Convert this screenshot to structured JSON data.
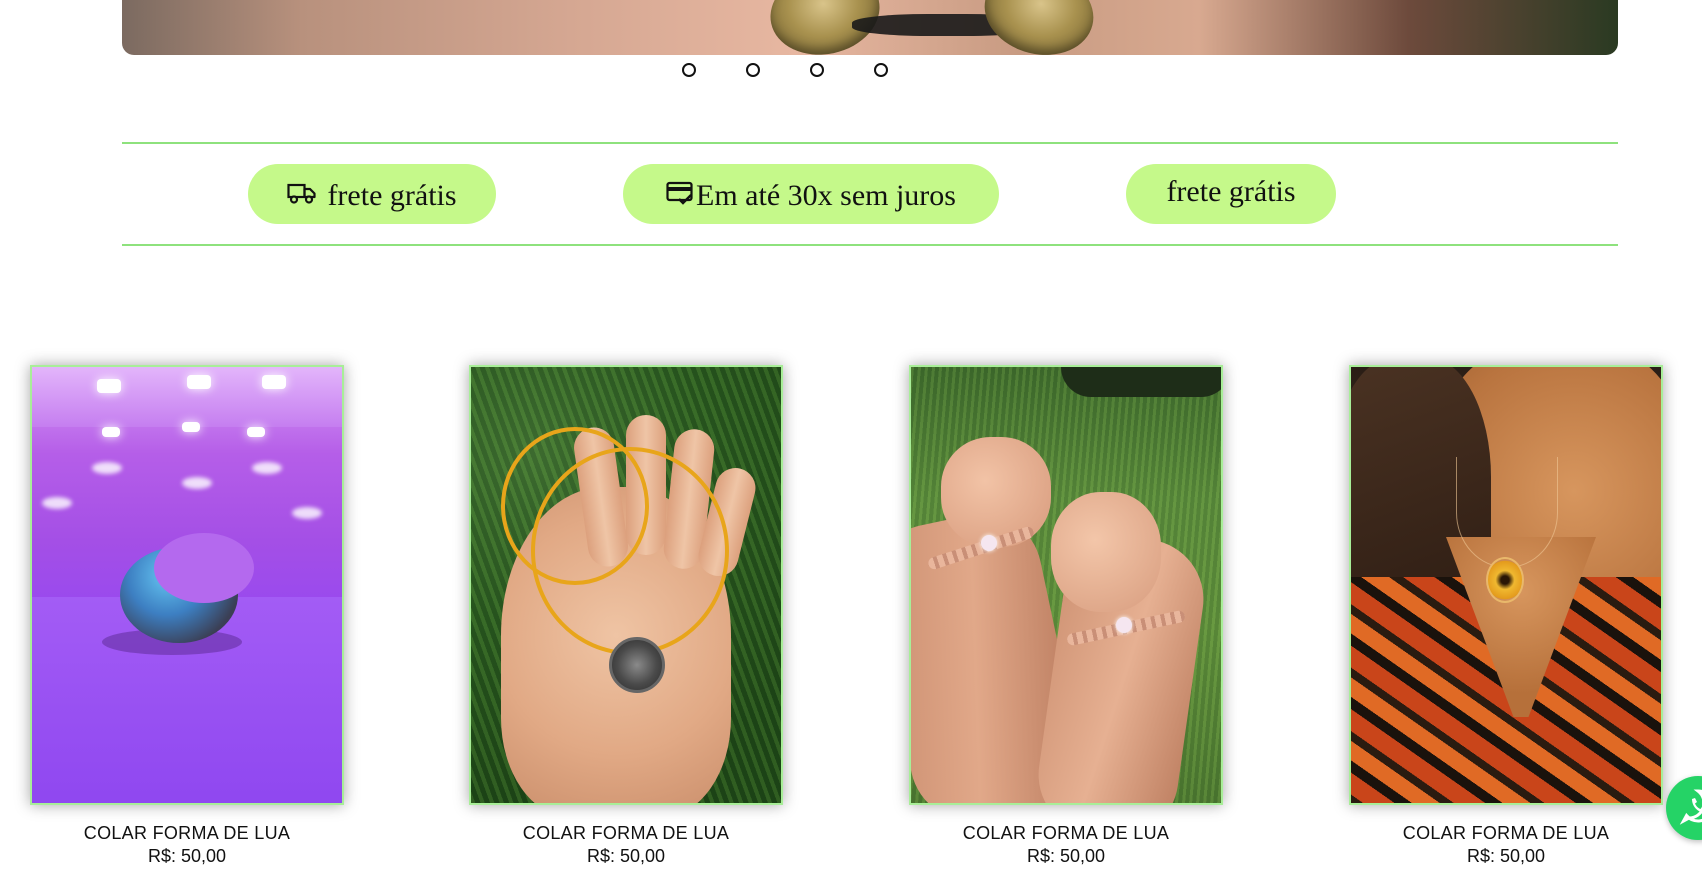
{
  "carousel": {
    "slide_count": 4,
    "indicators": [
      "slide-1",
      "slide-2",
      "slide-3",
      "slide-4"
    ]
  },
  "benefits": [
    {
      "icon": "truck-icon",
      "label": "frete grátis"
    },
    {
      "icon": "card-check-icon",
      "label": "Em até 30x sem juros"
    },
    {
      "icon": "",
      "label": "frete grátis"
    }
  ],
  "products": [
    {
      "name": "COLAR FORMA DE LUA",
      "price": "R$: 50,00"
    },
    {
      "name": "COLAR FORMA DE LUA",
      "price": "R$: 50,00"
    },
    {
      "name": "COLAR FORMA DE LUA",
      "price": "R$: 50,00"
    },
    {
      "name": "COLAR FORMA DE LUA",
      "price": "R$: 50,00"
    }
  ],
  "colors": {
    "accent_green": "#c5f98a",
    "divider_green": "#8ee27d",
    "whatsapp_green": "#25d366"
  },
  "floating": {
    "icon": "whatsapp-icon"
  }
}
